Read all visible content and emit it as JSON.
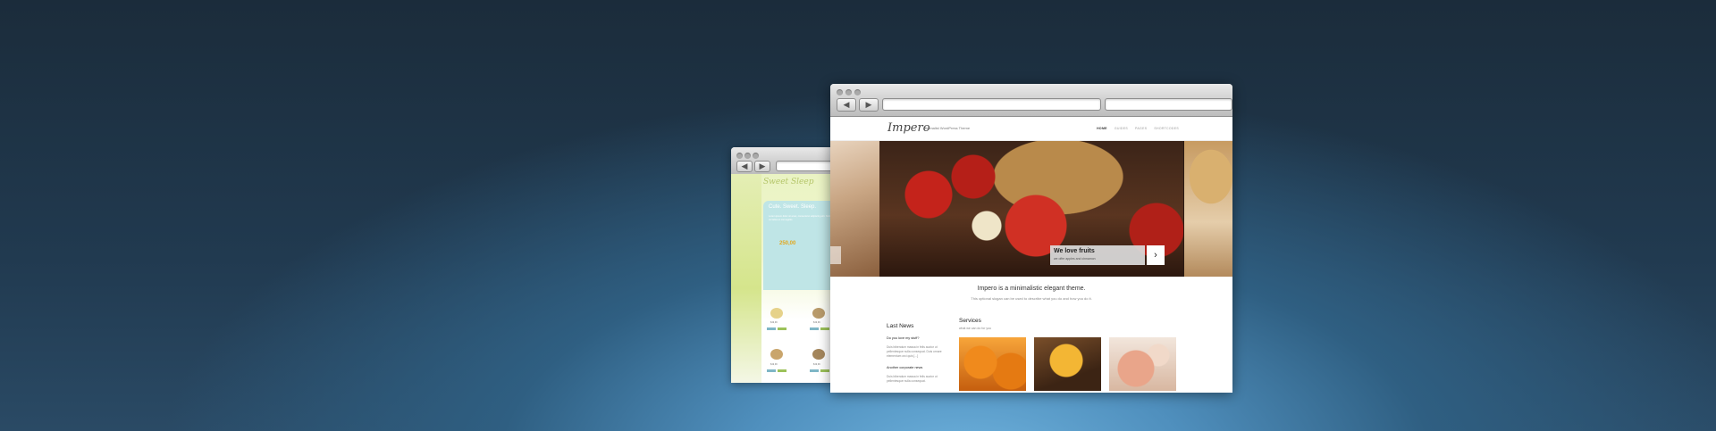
{
  "back_window": {
    "logo": "Sweet Sleep",
    "hero_title": "Cute. Sweet. Sleep.",
    "hero_text": "Lorem ipsum dolor sit amet, consectetur adipiscing elit. Nulla vel tellus et nisi sagittis.",
    "price": "250,00",
    "products": [
      {
        "price": "$19,99"
      },
      {
        "price": "$19,99"
      },
      {
        "price": "$19,99"
      },
      {
        "price": "$19,99"
      }
    ]
  },
  "front_window": {
    "site": {
      "logo": "Impero",
      "tagline": "Minimalist WordPress Theme",
      "menu": [
        "HOME",
        "GUIDES",
        "PAGES",
        "SHORTCODES"
      ]
    },
    "slider": {
      "caption_title": "We love fruits",
      "caption_subtitle": "we offer apples and cinnamon",
      "next_icon": "chevron-right-icon"
    },
    "intro": {
      "title": "Impero is a minimalistic elegant theme.",
      "subtitle": "This optional slogan can be used to describe what you do and how you do it."
    },
    "news": {
      "heading": "Last News",
      "items": [
        {
          "title": "Do you love my stuff?",
          "text": "Duis bibendum massa in felis auctor ut pellentesque nulla consequat. Duis ornare elementum orci quis [...]"
        },
        {
          "title": "Another corporate news",
          "text": "Duis bibendum massa in felis auctor ut pellentesque nulla consequat."
        }
      ]
    },
    "services": {
      "heading": "Services",
      "subheading": "what we can do for you"
    }
  }
}
